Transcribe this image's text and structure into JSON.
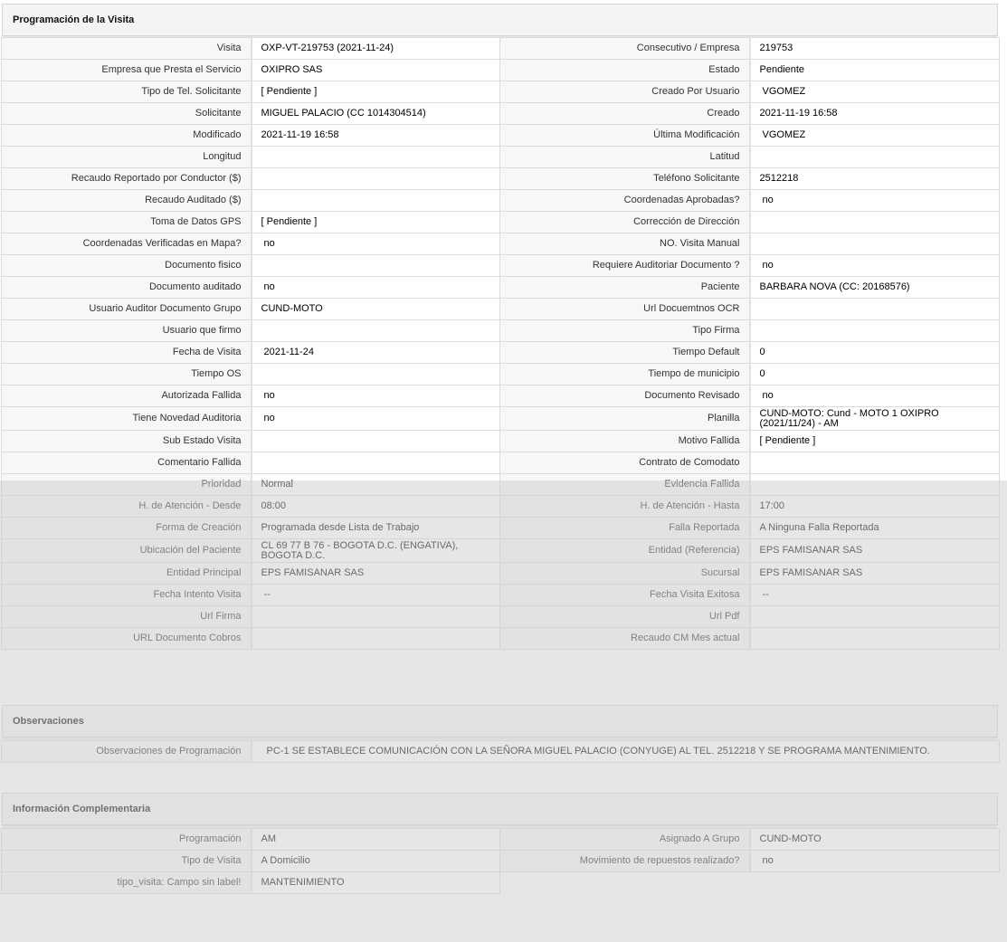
{
  "sections": {
    "programacion": {
      "title": "Programación de la Visita"
    },
    "observaciones": {
      "title": "Observaciones"
    },
    "complementaria": {
      "title": "Información Complementaria"
    }
  },
  "rows": [
    {
      "l1": "Visita",
      "v1": "OXP-VT-219753 (2021-11-24)",
      "l2": "Consecutivo / Empresa",
      "v2": "219753"
    },
    {
      "l1": "Empresa que Presta el Servicio",
      "v1": "OXIPRO SAS",
      "l2": "Estado",
      "v2": "Pendiente"
    },
    {
      "l1": "Tipo de Tel. Solicitante",
      "v1": "[ Pendiente ]",
      "l2": "Creado Por Usuario",
      "v2": "VGOMEZ"
    },
    {
      "l1": "Solicitante",
      "v1": "MIGUEL PALACIO (CC 1014304514)",
      "l2": "Creado",
      "v2": "2021-11-19 16:58"
    },
    {
      "l1": "Modificado",
      "v1": "2021-11-19 16:58",
      "l2": "Última Modificación",
      "v2": "VGOMEZ"
    },
    {
      "l1": "Longitud",
      "v1": "",
      "l2": "Latitud",
      "v2": ""
    },
    {
      "l1": "Recaudo Reportado por Conductor ($)",
      "v1": "",
      "l2": "Teléfono Solicitante",
      "v2": "2512218"
    },
    {
      "l1": "Recaudo Auditado ($)",
      "v1": "",
      "l2": "Coordenadas Aprobadas?",
      "v2": "no"
    },
    {
      "l1": "Toma de Datos GPS",
      "v1": "[ Pendiente ]",
      "l2": "Corrección de Dirección",
      "v2": ""
    },
    {
      "l1": "Coordenadas Verificadas en Mapa?",
      "v1": "no",
      "l2": "NO. Visita Manual",
      "v2": ""
    },
    {
      "l1": "Documento fisico",
      "v1": "",
      "l2": "Requiere Auditoriar Documento ?",
      "v2": "no"
    },
    {
      "l1": "Documento auditado",
      "v1": "no",
      "l2": "Paciente",
      "v2": "BARBARA NOVA (CC: 20168576)"
    },
    {
      "l1": "Usuario Auditor Documento Grupo",
      "v1": "CUND-MOTO",
      "l2": "Url Docuemtnos OCR",
      "v2": ""
    },
    {
      "l1": "Usuario que firmo",
      "v1": "",
      "l2": "Tipo Firma",
      "v2": ""
    },
    {
      "l1": "Fecha de Visita",
      "v1": "2021-11-24",
      "l2": "Tiempo Default",
      "v2": "0"
    },
    {
      "l1": "Tiempo OS",
      "v1": "",
      "l2": "Tiempo de municipio",
      "v2": "0"
    },
    {
      "l1": "Autorizada Fallida",
      "v1": "no",
      "l2": "Documento Revisado",
      "v2": "no"
    },
    {
      "l1": "Tiene Novedad Auditoria",
      "v1": "no",
      "l2": "Planilla",
      "v2": "CUND-MOTO: Cund - MOTO 1 OXIPRO (2021/11/24) - AM"
    },
    {
      "l1": "Sub Estado Visita",
      "v1": "",
      "l2": "Motivo Fallida",
      "v2": "[ Pendiente ]"
    },
    {
      "l1": "Comentario Fallida",
      "v1": "",
      "l2": "Contrato de Comodato",
      "v2": ""
    },
    {
      "l1": "Prioridad",
      "v1": "Normal",
      "l2": "Evidencia Fallida",
      "v2": ""
    },
    {
      "l1": "H. de Atención - Desde",
      "v1": "08:00",
      "l2": "H. de Atención - Hasta",
      "v2": "17:00"
    },
    {
      "l1": "Forma de Creación",
      "v1": "Programada desde Lista de Trabajo",
      "l2": "Falla Reportada",
      "v2": "A Ninguna Falla Reportada"
    },
    {
      "l1": "Ubicación del Paciente",
      "v1": "CL 69 77 B 76 - BOGOTA D.C. (ENGATIVA), BOGOTA D.C.",
      "l2": "Entidad (Referencia)",
      "v2": "EPS FAMISANAR SAS"
    },
    {
      "l1": "Entidad Principal",
      "v1": "EPS FAMISANAR SAS",
      "l2": "Sucursal",
      "v2": "EPS FAMISANAR SAS"
    },
    {
      "l1": "Fecha Intento Visita",
      "v1": "--",
      "l2": "Fecha Visita Exitosa",
      "v2": "--"
    },
    {
      "l1": "Url Firma",
      "v1": "",
      "l2": "Url Pdf",
      "v2": ""
    },
    {
      "l1": "URL Documento Cobros",
      "v1": "",
      "l2": "Recaudo CM Mes actual",
      "v2": ""
    }
  ],
  "observaciones": {
    "label": "Observaciones de Programación",
    "value": "PC-1 SE ESTABLECE COMUNICACIÓN CON LA SEÑORA MIGUEL PALACIO (CONYUGE) AL TEL. 2512218 Y SE PROGRAMA MANTENIMIENTO."
  },
  "complementaria": [
    {
      "l1": "Programación",
      "v1": "AM",
      "l2": "Asignado A Grupo",
      "v2": "CUND-MOTO"
    },
    {
      "l1": "Tipo de Visita",
      "v1": "A Domicilio",
      "l2": "Movimiento de repuestos realizado?",
      "v2": "no"
    },
    {
      "l1": "tipo_visita: Campo sin label!",
      "v1": "MANTENIMIENTO",
      "l2": "",
      "v2": ""
    }
  ]
}
